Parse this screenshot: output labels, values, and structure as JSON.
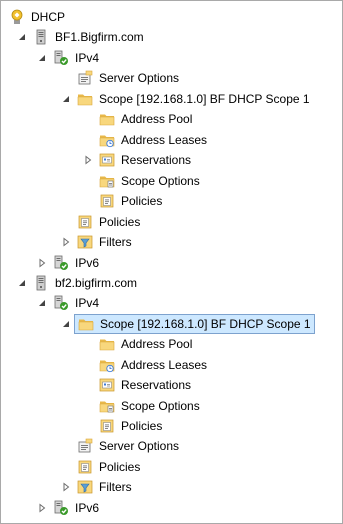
{
  "tree": {
    "root": {
      "label": "DHCP",
      "icon": "dhcp-icon"
    },
    "servers": [
      {
        "label": "BF1.Bigfirm.com",
        "icon": "server-icon",
        "ipv4": {
          "label": "IPv4",
          "server_options": "Server Options",
          "scope": {
            "label": "Scope [192.168.1.0] BF DHCP Scope 1",
            "address_pool": "Address Pool",
            "address_leases": "Address Leases",
            "reservations": "Reservations",
            "scope_options": "Scope Options",
            "policies": "Policies"
          },
          "policies": "Policies",
          "filters": "Filters"
        },
        "ipv6": {
          "label": "IPv6"
        }
      },
      {
        "label": "bf2.bigfirm.com",
        "icon": "server-icon",
        "ipv4": {
          "label": "IPv4",
          "scope": {
            "label": "Scope [192.168.1.0] BF DHCP Scope 1",
            "address_pool": "Address Pool",
            "address_leases": "Address Leases",
            "reservations": "Reservations",
            "scope_options": "Scope Options",
            "policies": "Policies"
          },
          "server_options": "Server Options",
          "policies": "Policies",
          "filters": "Filters"
        },
        "ipv6": {
          "label": "IPv6"
        }
      }
    ]
  },
  "colors": {
    "folder": "#f5d27a",
    "selection_bg": "#cde8ff",
    "selection_border": "#7da2ce",
    "green_check": "#3a9a2a"
  }
}
